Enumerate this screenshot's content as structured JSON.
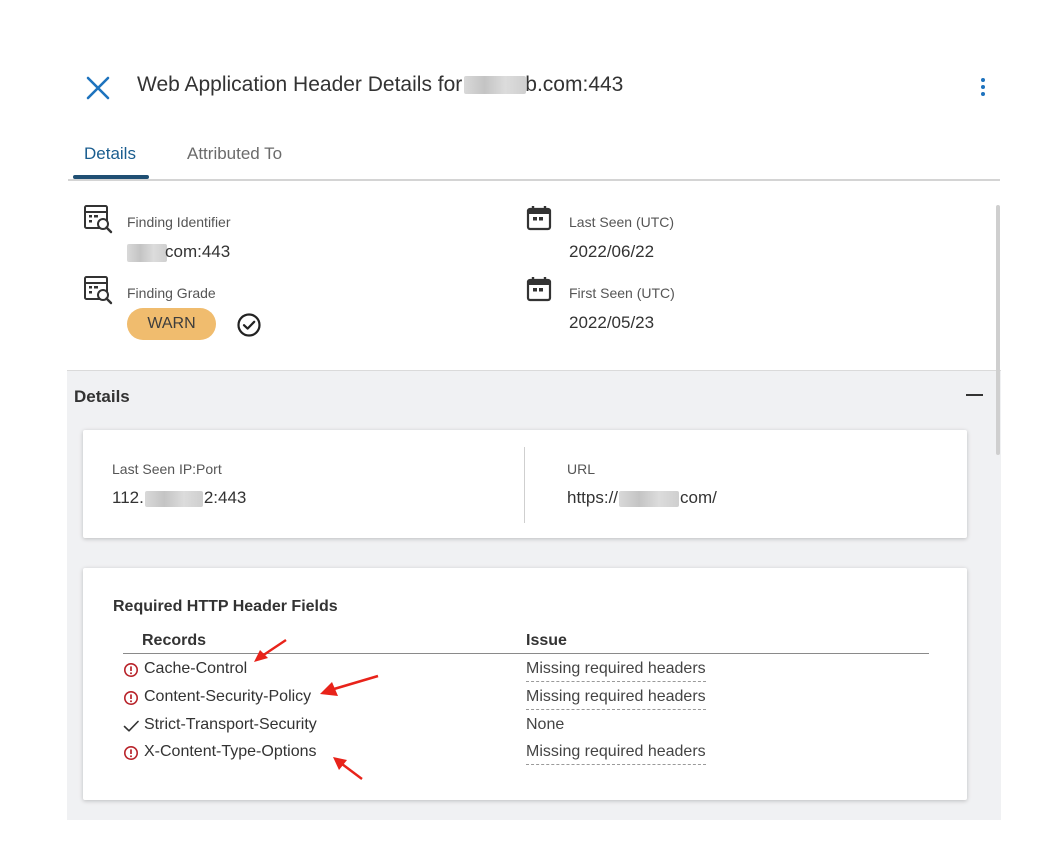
{
  "header": {
    "title_prefix": "Web Application Header Details for",
    "title_suffix": "b.com:443"
  },
  "tabs": [
    {
      "label": "Details",
      "active": true
    },
    {
      "label": "Attributed To",
      "active": false
    }
  ],
  "summary": {
    "finding_identifier": {
      "label": "Finding Identifier",
      "value": "com:443"
    },
    "finding_grade": {
      "label": "Finding Grade",
      "value": "WARN"
    },
    "last_seen": {
      "label": "Last Seen (UTC)",
      "value": "2022/06/22"
    },
    "first_seen": {
      "label": "First Seen (UTC)",
      "value": "2022/05/23"
    }
  },
  "details": {
    "heading": "Details",
    "last_seen_ip": {
      "label": "Last Seen IP:Port",
      "value_prefix": "112.",
      "value_suffix": "2:443"
    },
    "url": {
      "label": "URL",
      "value_prefix": "https://",
      "value_suffix": "com/"
    }
  },
  "http_headers": {
    "title": "Required HTTP Header Fields",
    "col_records": "Records",
    "col_issue": "Issue",
    "rows": [
      {
        "record": "Cache-Control",
        "issue": "Missing required headers",
        "status": "error"
      },
      {
        "record": "Content-Security-Policy",
        "issue": "Missing required headers",
        "status": "error"
      },
      {
        "record": "Strict-Transport-Security",
        "issue": "None",
        "status": "ok"
      },
      {
        "record": "X-Content-Type-Options",
        "issue": "Missing required headers",
        "status": "error"
      }
    ]
  },
  "colors": {
    "accent": "#1a5d8f",
    "warn_badge": "#f0bc6e",
    "error_icon": "#b8232a",
    "annotation_arrow": "#e8231a"
  },
  "icons": [
    "close-icon",
    "kebab-menu-icon",
    "finding-search-icon",
    "calendar-icon",
    "check-circle-icon",
    "collapse-minus-icon",
    "error-circle-icon",
    "checkmark-icon"
  ]
}
